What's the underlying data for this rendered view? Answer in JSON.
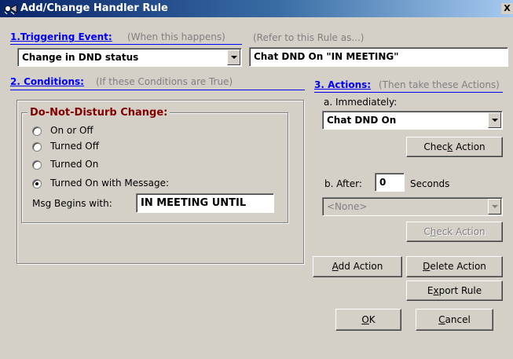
{
  "window": {
    "title": "Add/Change Handler Rule",
    "close_glyph": "X"
  },
  "trigger": {
    "heading": "1.Triggering Event:",
    "hint": "(When this happens)",
    "selected": "Change in DND status",
    "refer_hint": "(Refer to this Rule as...)",
    "rule_name": "Chat DND On \"IN MEETING\""
  },
  "conditions": {
    "heading": "2. Conditions:",
    "hint": "(If these Conditions are True)",
    "group_label": "Do-Not-Disturb Change:",
    "options": [
      "On or Off",
      "Turned Off",
      "Turned On",
      "Turned On with Message:"
    ],
    "selected_index": 3,
    "msg_label": "Msg Begins with:",
    "msg_value": "IN MEETING UNTIL"
  },
  "actions": {
    "heading": "3. Actions:",
    "hint": "(Then take these Actions)",
    "immediately_label": "a. Immediately:",
    "immediate_action": "Chat DND On",
    "check_action": {
      "pre": "Chec",
      "key": "k",
      "post": " Action"
    },
    "after_label": "b. After:",
    "after_value": "0",
    "seconds_label": "Seconds",
    "after_action": "<None>",
    "check_action2": {
      "pre": "C",
      "key": "h",
      "post": "eck Action"
    },
    "add_action": {
      "key": "A",
      "post": "dd Action"
    },
    "delete_action": {
      "key": "D",
      "post": "elete Action"
    },
    "export_rule": {
      "pre": "E",
      "key": "x",
      "post": "port Rule"
    },
    "ok": {
      "key": "O",
      "post": "K"
    },
    "cancel": {
      "key": "C",
      "post": "ancel"
    }
  },
  "colors": {
    "title_start": "#0a246a",
    "title_end": "#a6caf0",
    "section": "#0000ff",
    "group_label": "#800000",
    "face": "#d4d0c8"
  }
}
